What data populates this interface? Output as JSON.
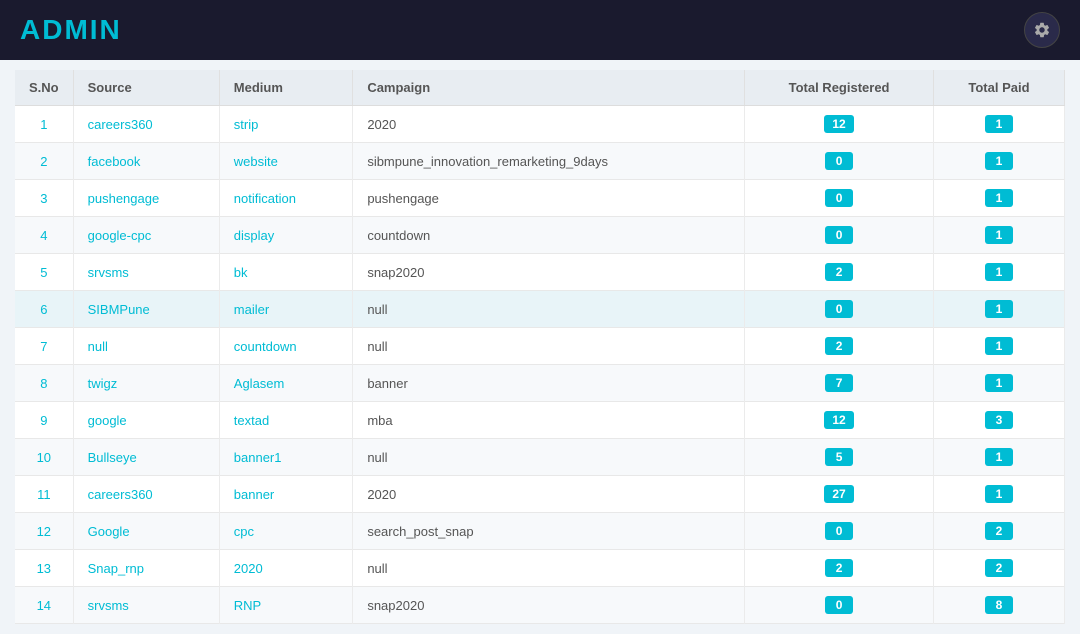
{
  "header": {
    "title": "ADMIN",
    "settings_icon": "settings"
  },
  "table": {
    "columns": [
      "S.No",
      "Source",
      "Medium",
      "Campaign",
      "Total Registered",
      "Total Paid"
    ],
    "rows": [
      {
        "sno": 1,
        "source": "careers360",
        "medium": "strip",
        "campaign": "2020",
        "total_registered": 12,
        "total_paid": 1
      },
      {
        "sno": 2,
        "source": "facebook",
        "medium": "website",
        "campaign": "sibmpune_innovation_remarketing_9days",
        "total_registered": 0,
        "total_paid": 1
      },
      {
        "sno": 3,
        "source": "pushengage",
        "medium": "notification",
        "campaign": "pushengage",
        "total_registered": 0,
        "total_paid": 1
      },
      {
        "sno": 4,
        "source": "google-cpc",
        "medium": "display",
        "campaign": "countdown",
        "total_registered": 0,
        "total_paid": 1
      },
      {
        "sno": 5,
        "source": "srvsms",
        "medium": "bk",
        "campaign": "snap2020",
        "total_registered": 2,
        "total_paid": 1
      },
      {
        "sno": 6,
        "source": "SIBMPune",
        "medium": "mailer",
        "campaign": "null",
        "total_registered": 0,
        "total_paid": 1,
        "highlighted": true
      },
      {
        "sno": 7,
        "source": "null",
        "medium": "countdown",
        "campaign": "null",
        "total_registered": 2,
        "total_paid": 1
      },
      {
        "sno": 8,
        "source": "twigz",
        "medium": "Aglasem",
        "campaign": "banner",
        "total_registered": 7,
        "total_paid": 1
      },
      {
        "sno": 9,
        "source": "google",
        "medium": "textad",
        "campaign": "mba",
        "total_registered": 12,
        "total_paid": 3
      },
      {
        "sno": 10,
        "source": "Bullseye",
        "medium": "banner1",
        "campaign": "null",
        "total_registered": 5,
        "total_paid": 1
      },
      {
        "sno": 11,
        "source": "careers360",
        "medium": "banner",
        "campaign": "2020",
        "total_registered": 27,
        "total_paid": 1
      },
      {
        "sno": 12,
        "source": "Google",
        "medium": "cpc",
        "campaign": "search_post_snap",
        "total_registered": 0,
        "total_paid": 2
      },
      {
        "sno": 13,
        "source": "Snap_rnp",
        "medium": "2020",
        "campaign": "null",
        "total_registered": 2,
        "total_paid": 2
      },
      {
        "sno": 14,
        "source": "srvsms",
        "medium": "RNP",
        "campaign": "snap2020",
        "total_registered": 0,
        "total_paid": 8
      }
    ]
  }
}
